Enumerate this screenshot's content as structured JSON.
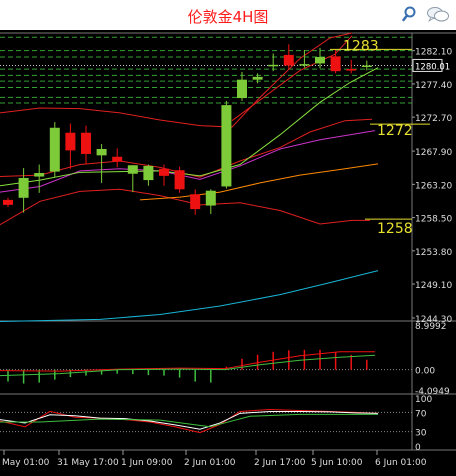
{
  "app": {
    "title": "伦敦金4H图",
    "icons": {
      "search": "search-icon",
      "chat": "chat-icon"
    }
  },
  "chart_data": [
    {
      "type": "candlestick",
      "ylim": [
        1244.3,
        1284.6
      ],
      "price_ticks": [
        "1282.10",
        "1277.40",
        "1272.70",
        "1267.90",
        "1263.20",
        "1258.50",
        "1253.80",
        "1249.10",
        "1244.30"
      ],
      "current_price": "1280.01",
      "annotations": [
        "1283",
        "1272",
        "1258"
      ],
      "candles": [
        {
          "o": 1261.0,
          "h": 1261.3,
          "l": 1260.0,
          "c": 1260.3
        },
        {
          "o": 1261.3,
          "h": 1265.5,
          "l": 1259.2,
          "c": 1264.1
        },
        {
          "o": 1264.3,
          "h": 1266.0,
          "l": 1262.0,
          "c": 1264.8
        },
        {
          "o": 1265.0,
          "h": 1272.0,
          "l": 1264.2,
          "c": 1271.2
        },
        {
          "o": 1270.5,
          "h": 1271.8,
          "l": 1265.4,
          "c": 1268.0
        },
        {
          "o": 1270.5,
          "h": 1271.5,
          "l": 1266.0,
          "c": 1267.5
        },
        {
          "o": 1267.3,
          "h": 1268.9,
          "l": 1263.4,
          "c": 1268.2
        },
        {
          "o": 1267.1,
          "h": 1268.3,
          "l": 1265.6,
          "c": 1266.4
        },
        {
          "o": 1264.7,
          "h": 1265.9,
          "l": 1262.1,
          "c": 1265.9
        },
        {
          "o": 1263.8,
          "h": 1266.0,
          "l": 1263.0,
          "c": 1265.8
        },
        {
          "o": 1265.4,
          "h": 1266.0,
          "l": 1263.0,
          "c": 1264.4
        },
        {
          "o": 1265.2,
          "h": 1265.7,
          "l": 1262.0,
          "c": 1262.5
        },
        {
          "o": 1261.8,
          "h": 1262.5,
          "l": 1258.9,
          "c": 1259.7
        },
        {
          "o": 1260.2,
          "h": 1262.5,
          "l": 1259.0,
          "c": 1262.3
        },
        {
          "o": 1262.9,
          "h": 1275.0,
          "l": 1262.6,
          "c": 1274.4
        },
        {
          "o": 1275.4,
          "h": 1279.1,
          "l": 1275.0,
          "c": 1278.0
        },
        {
          "o": 1278.0,
          "h": 1278.9,
          "l": 1277.5,
          "c": 1278.4
        },
        {
          "o": 1280.0,
          "h": 1281.7,
          "l": 1279.2,
          "c": 1280.1
        },
        {
          "o": 1281.5,
          "h": 1283.0,
          "l": 1279.4,
          "c": 1280.0
        },
        {
          "o": 1280.1,
          "h": 1282.2,
          "l": 1279.7,
          "c": 1280.2
        },
        {
          "o": 1280.3,
          "h": 1282.5,
          "l": 1279.6,
          "c": 1281.2
        },
        {
          "o": 1281.3,
          "h": 1282.3,
          "l": 1278.9,
          "c": 1279.2
        },
        {
          "o": 1279.5,
          "h": 1280.8,
          "l": 1278.9,
          "c": 1279.3
        },
        {
          "o": 1279.9,
          "h": 1280.7,
          "l": 1279.3,
          "c": 1280.0
        }
      ]
    },
    {
      "type": "histogram",
      "ylim": [
        -4.0949,
        8.9992
      ],
      "ticks": [
        "8.9992",
        "0.00",
        "-4.0949"
      ]
    },
    {
      "type": "line",
      "ylim": [
        0,
        100
      ],
      "ticks": [
        "100",
        "70",
        "30",
        "0"
      ]
    }
  ],
  "x_labels": [
    "May 01:00",
    "31 May 17:00",
    "1 Jun 09:00",
    "2 Jun 01:00",
    "2 Jun 17:00",
    "5 Jun 10:00",
    "6 Jun 01:00"
  ]
}
